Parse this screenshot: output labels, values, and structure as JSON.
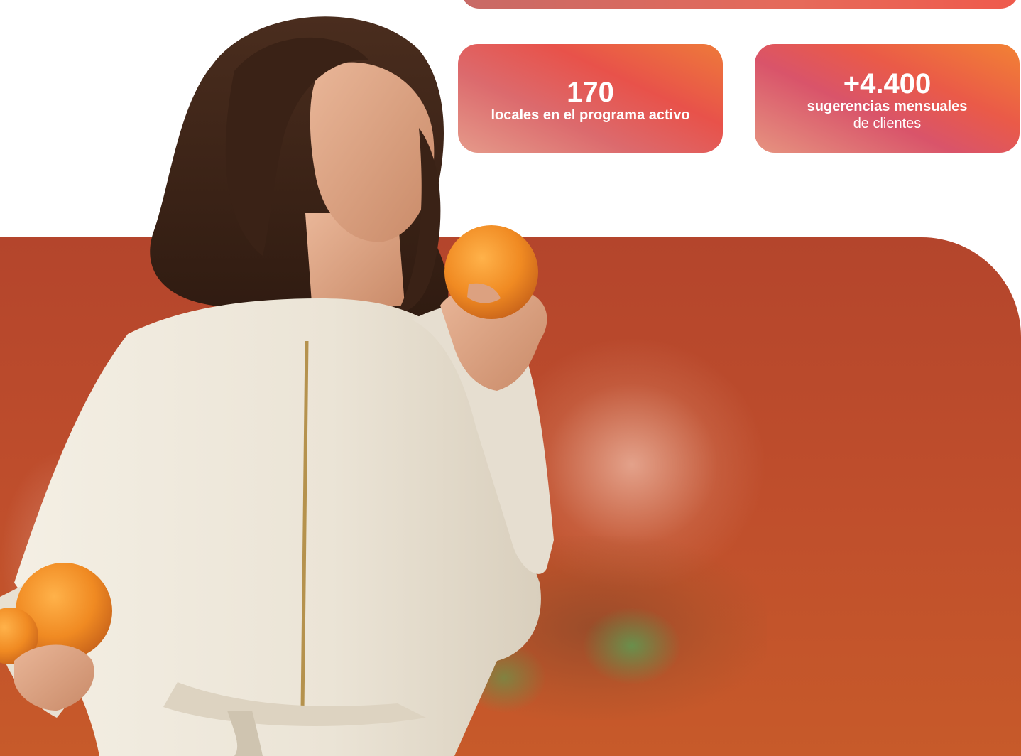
{
  "stats": [
    {
      "number": "170",
      "label_bold": "locales en el programa activo",
      "label_regular": ""
    },
    {
      "number": "+4.400",
      "label_bold": "sugerencias mensuales",
      "label_regular": "de clientes"
    }
  ],
  "colors": {
    "panel": "#bf4e2c",
    "card_gradient_start": "#e59a8a",
    "card_gradient_end": "#ee7a3a",
    "dress": "#efe9dc",
    "hair": "#3b2418",
    "orange": "#f0902a"
  }
}
